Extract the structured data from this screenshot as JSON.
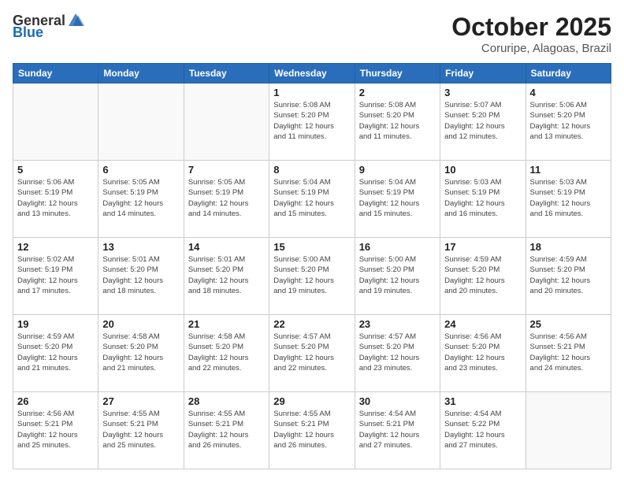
{
  "header": {
    "logo_general": "General",
    "logo_blue": "Blue",
    "month": "October 2025",
    "location": "Coruripe, Alagoas, Brazil"
  },
  "days_of_week": [
    "Sunday",
    "Monday",
    "Tuesday",
    "Wednesday",
    "Thursday",
    "Friday",
    "Saturday"
  ],
  "weeks": [
    [
      {
        "num": "",
        "info": ""
      },
      {
        "num": "",
        "info": ""
      },
      {
        "num": "",
        "info": ""
      },
      {
        "num": "1",
        "info": "Sunrise: 5:08 AM\nSunset: 5:20 PM\nDaylight: 12 hours\nand 11 minutes."
      },
      {
        "num": "2",
        "info": "Sunrise: 5:08 AM\nSunset: 5:20 PM\nDaylight: 12 hours\nand 11 minutes."
      },
      {
        "num": "3",
        "info": "Sunrise: 5:07 AM\nSunset: 5:20 PM\nDaylight: 12 hours\nand 12 minutes."
      },
      {
        "num": "4",
        "info": "Sunrise: 5:06 AM\nSunset: 5:20 PM\nDaylight: 12 hours\nand 13 minutes."
      }
    ],
    [
      {
        "num": "5",
        "info": "Sunrise: 5:06 AM\nSunset: 5:19 PM\nDaylight: 12 hours\nand 13 minutes."
      },
      {
        "num": "6",
        "info": "Sunrise: 5:05 AM\nSunset: 5:19 PM\nDaylight: 12 hours\nand 14 minutes."
      },
      {
        "num": "7",
        "info": "Sunrise: 5:05 AM\nSunset: 5:19 PM\nDaylight: 12 hours\nand 14 minutes."
      },
      {
        "num": "8",
        "info": "Sunrise: 5:04 AM\nSunset: 5:19 PM\nDaylight: 12 hours\nand 15 minutes."
      },
      {
        "num": "9",
        "info": "Sunrise: 5:04 AM\nSunset: 5:19 PM\nDaylight: 12 hours\nand 15 minutes."
      },
      {
        "num": "10",
        "info": "Sunrise: 5:03 AM\nSunset: 5:19 PM\nDaylight: 12 hours\nand 16 minutes."
      },
      {
        "num": "11",
        "info": "Sunrise: 5:03 AM\nSunset: 5:19 PM\nDaylight: 12 hours\nand 16 minutes."
      }
    ],
    [
      {
        "num": "12",
        "info": "Sunrise: 5:02 AM\nSunset: 5:19 PM\nDaylight: 12 hours\nand 17 minutes."
      },
      {
        "num": "13",
        "info": "Sunrise: 5:01 AM\nSunset: 5:20 PM\nDaylight: 12 hours\nand 18 minutes."
      },
      {
        "num": "14",
        "info": "Sunrise: 5:01 AM\nSunset: 5:20 PM\nDaylight: 12 hours\nand 18 minutes."
      },
      {
        "num": "15",
        "info": "Sunrise: 5:00 AM\nSunset: 5:20 PM\nDaylight: 12 hours\nand 19 minutes."
      },
      {
        "num": "16",
        "info": "Sunrise: 5:00 AM\nSunset: 5:20 PM\nDaylight: 12 hours\nand 19 minutes."
      },
      {
        "num": "17",
        "info": "Sunrise: 4:59 AM\nSunset: 5:20 PM\nDaylight: 12 hours\nand 20 minutes."
      },
      {
        "num": "18",
        "info": "Sunrise: 4:59 AM\nSunset: 5:20 PM\nDaylight: 12 hours\nand 20 minutes."
      }
    ],
    [
      {
        "num": "19",
        "info": "Sunrise: 4:59 AM\nSunset: 5:20 PM\nDaylight: 12 hours\nand 21 minutes."
      },
      {
        "num": "20",
        "info": "Sunrise: 4:58 AM\nSunset: 5:20 PM\nDaylight: 12 hours\nand 21 minutes."
      },
      {
        "num": "21",
        "info": "Sunrise: 4:58 AM\nSunset: 5:20 PM\nDaylight: 12 hours\nand 22 minutes."
      },
      {
        "num": "22",
        "info": "Sunrise: 4:57 AM\nSunset: 5:20 PM\nDaylight: 12 hours\nand 22 minutes."
      },
      {
        "num": "23",
        "info": "Sunrise: 4:57 AM\nSunset: 5:20 PM\nDaylight: 12 hours\nand 23 minutes."
      },
      {
        "num": "24",
        "info": "Sunrise: 4:56 AM\nSunset: 5:20 PM\nDaylight: 12 hours\nand 23 minutes."
      },
      {
        "num": "25",
        "info": "Sunrise: 4:56 AM\nSunset: 5:21 PM\nDaylight: 12 hours\nand 24 minutes."
      }
    ],
    [
      {
        "num": "26",
        "info": "Sunrise: 4:56 AM\nSunset: 5:21 PM\nDaylight: 12 hours\nand 25 minutes."
      },
      {
        "num": "27",
        "info": "Sunrise: 4:55 AM\nSunset: 5:21 PM\nDaylight: 12 hours\nand 25 minutes."
      },
      {
        "num": "28",
        "info": "Sunrise: 4:55 AM\nSunset: 5:21 PM\nDaylight: 12 hours\nand 26 minutes."
      },
      {
        "num": "29",
        "info": "Sunrise: 4:55 AM\nSunset: 5:21 PM\nDaylight: 12 hours\nand 26 minutes."
      },
      {
        "num": "30",
        "info": "Sunrise: 4:54 AM\nSunset: 5:21 PM\nDaylight: 12 hours\nand 27 minutes."
      },
      {
        "num": "31",
        "info": "Sunrise: 4:54 AM\nSunset: 5:22 PM\nDaylight: 12 hours\nand 27 minutes."
      },
      {
        "num": "",
        "info": ""
      }
    ]
  ]
}
